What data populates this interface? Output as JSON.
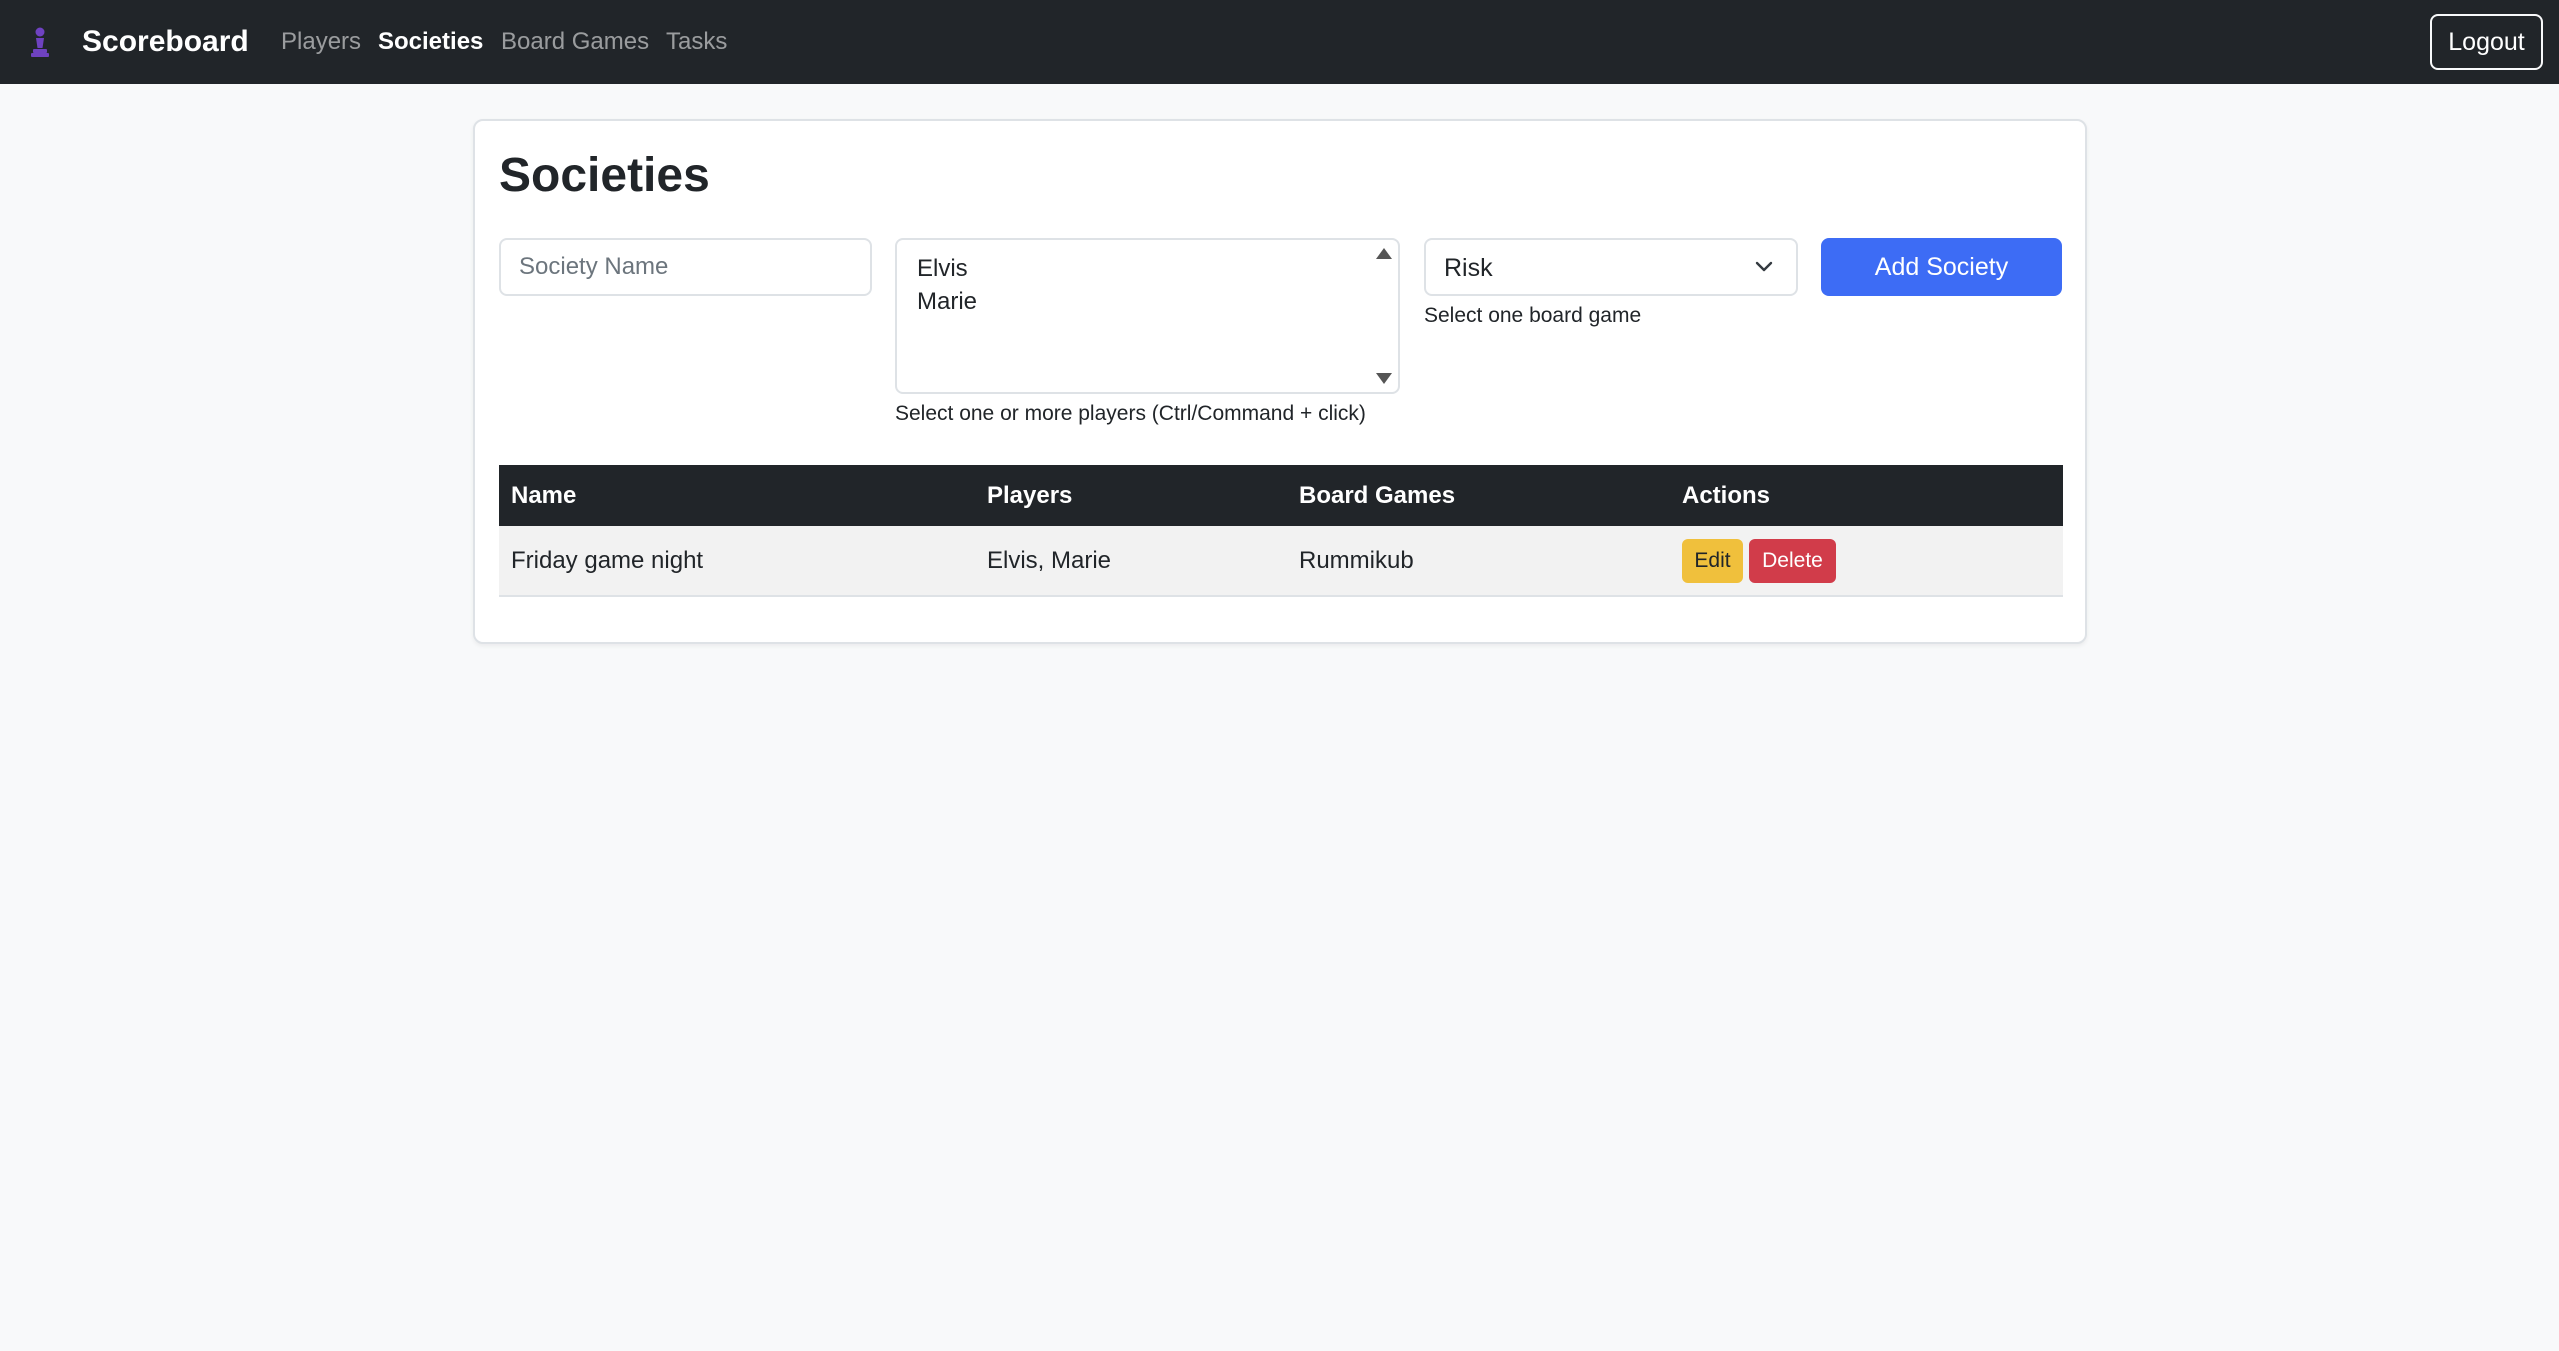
{
  "nav": {
    "brand": "Scoreboard",
    "brand_icon": "chess-pawn-icon",
    "links": [
      "Players",
      "Societies",
      "Board Games",
      "Tasks"
    ],
    "active": "Societies",
    "logout": "Logout"
  },
  "page": {
    "title": "Societies"
  },
  "form": {
    "name_placeholder": "Society Name",
    "name_value": "",
    "players_options": [
      "Elvis",
      "Marie"
    ],
    "players_help": "Select one or more players (Ctrl/Command + click)",
    "board_game_selected": "Risk",
    "board_game_help": "Select one board game",
    "add_button": "Add Society"
  },
  "table": {
    "headers": [
      "Name",
      "Players",
      "Board Games",
      "Actions"
    ],
    "rows": [
      {
        "name": "Friday game night",
        "players": "Elvis, Marie",
        "board_games": "Rummikub",
        "edit_label": "Edit",
        "delete_label": "Delete"
      }
    ]
  },
  "colors": {
    "navbar": "#212529",
    "primary": "#3d6cf5",
    "warning": "#f0c03c",
    "danger": "#d13c4a",
    "brand_icon": "#6f42c1"
  }
}
